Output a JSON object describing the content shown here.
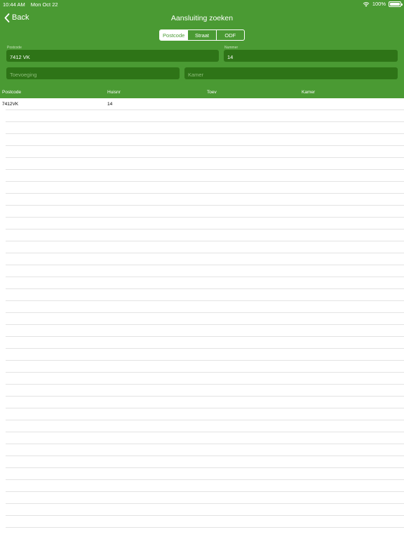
{
  "status_bar": {
    "time": "10:44 AM",
    "date": "Mon Oct 22",
    "battery": "100%",
    "battery_level": 1.0
  },
  "nav": {
    "back_label": "Back",
    "title": "Aansluiting zoeken"
  },
  "segments": [
    {
      "label": "Postcode",
      "active": true
    },
    {
      "label": "Straat",
      "active": false
    },
    {
      "label": "ODF",
      "active": false
    }
  ],
  "form": {
    "postcode": {
      "label": "Postcode",
      "value": "7412 VK"
    },
    "nummer": {
      "label": "Nummer",
      "value": "14"
    },
    "toevoeging": {
      "placeholder": "Toevoeging"
    },
    "kamer": {
      "placeholder": "Kamer"
    }
  },
  "table": {
    "columns": [
      "Postcode",
      "Huisnr",
      "Toev",
      "Kamer"
    ],
    "rows": [
      [
        "7412VK",
        "14",
        "",
        ""
      ]
    ]
  },
  "colors": {
    "accent": "#4a9a33",
    "field": "#2e7417",
    "divider": "#e3e3e3"
  }
}
